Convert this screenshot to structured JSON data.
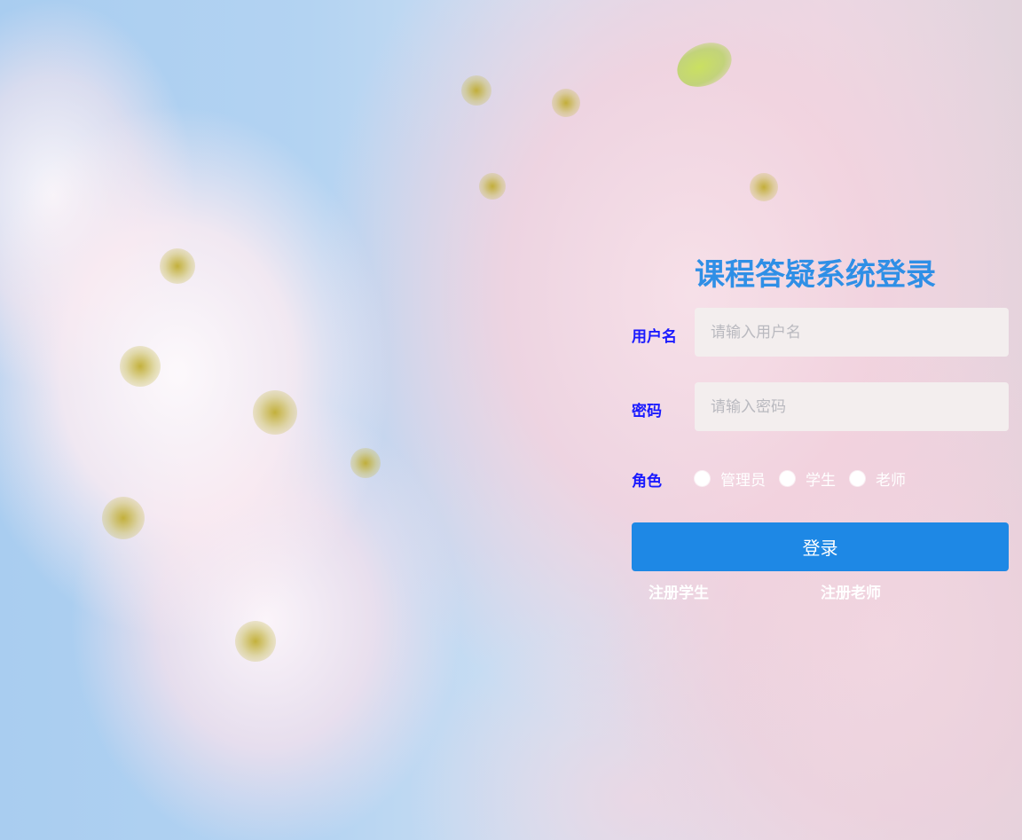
{
  "login": {
    "title": "课程答疑系统登录",
    "username_label": "用户名",
    "username_placeholder": "请输入用户名",
    "password_label": "密码",
    "password_placeholder": "请输入密码",
    "role_label": "角色",
    "roles": [
      "管理员",
      "学生",
      "老师"
    ],
    "submit_label": "登录",
    "register_student": "注册学生",
    "register_teacher": "注册老师"
  },
  "colors": {
    "title": "#2f8fe6",
    "label": "#1a1aff",
    "button": "#1e88e5",
    "input_bg": "#f3eeee"
  }
}
